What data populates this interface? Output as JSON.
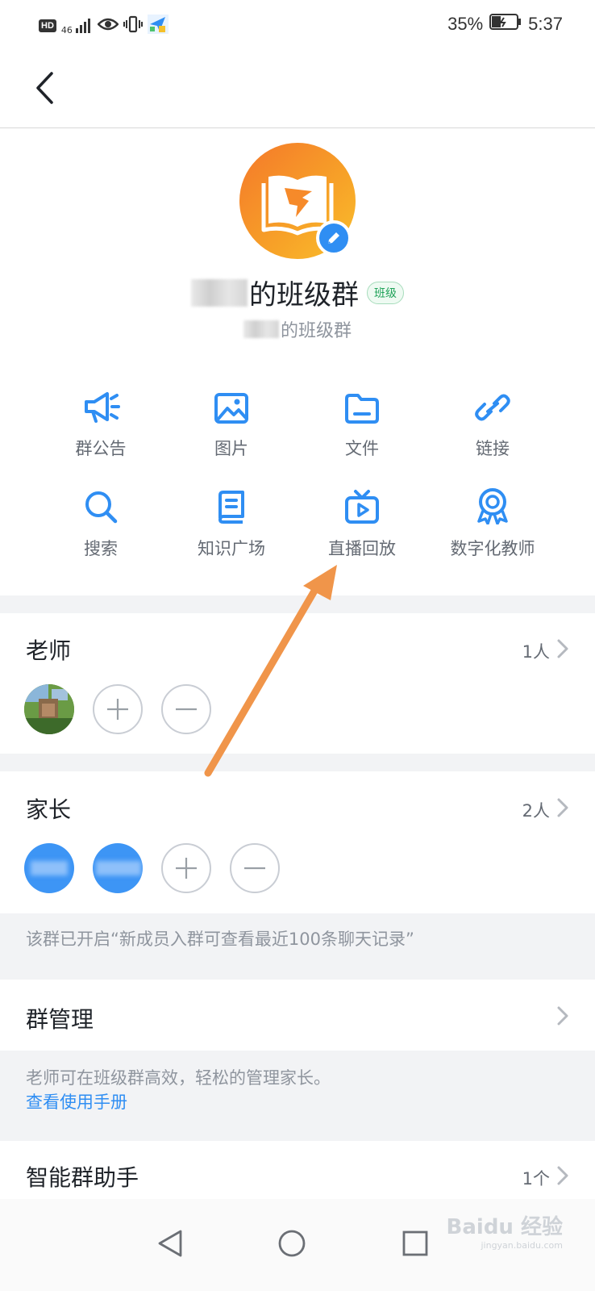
{
  "status_bar": {
    "left_badges": [
      "HD",
      "46"
    ],
    "battery": "35%",
    "time": "5:37"
  },
  "header": {
    "back_icon": "chevron-left-icon"
  },
  "group": {
    "name_suffix": "的班级群",
    "tag": "班级",
    "subtitle_suffix": "的班级群"
  },
  "features": [
    {
      "label": "群公告",
      "icon": "megaphone-icon"
    },
    {
      "label": "图片",
      "icon": "image-icon"
    },
    {
      "label": "文件",
      "icon": "folder-icon"
    },
    {
      "label": "链接",
      "icon": "link-icon"
    },
    {
      "label": "搜索",
      "icon": "search-icon"
    },
    {
      "label": "知识广场",
      "icon": "book-icon"
    },
    {
      "label": "直播回放",
      "icon": "tv-play-icon"
    },
    {
      "label": "数字化教师",
      "icon": "award-badge-icon"
    }
  ],
  "teachers": {
    "title": "老师",
    "count": "1人"
  },
  "parents": {
    "title": "家长",
    "count": "2人"
  },
  "history_note": "该群已开启“新成员入群可查看最近100条聊天记录”",
  "group_manage": {
    "title": "群管理",
    "note": "老师可在班级群高效，轻松的管理家长。",
    "link": "查看使用手册"
  },
  "assistant": {
    "title": "智能群助手",
    "count": "1个"
  },
  "watermark": {
    "text": "Baidu 经验",
    "url": "jingyan.baidu.com"
  },
  "colors": {
    "accent": "#2f8ef3",
    "avatar_orange": "#f7a228",
    "arrow": "#f0954a",
    "tag_green": "#21a35a"
  }
}
